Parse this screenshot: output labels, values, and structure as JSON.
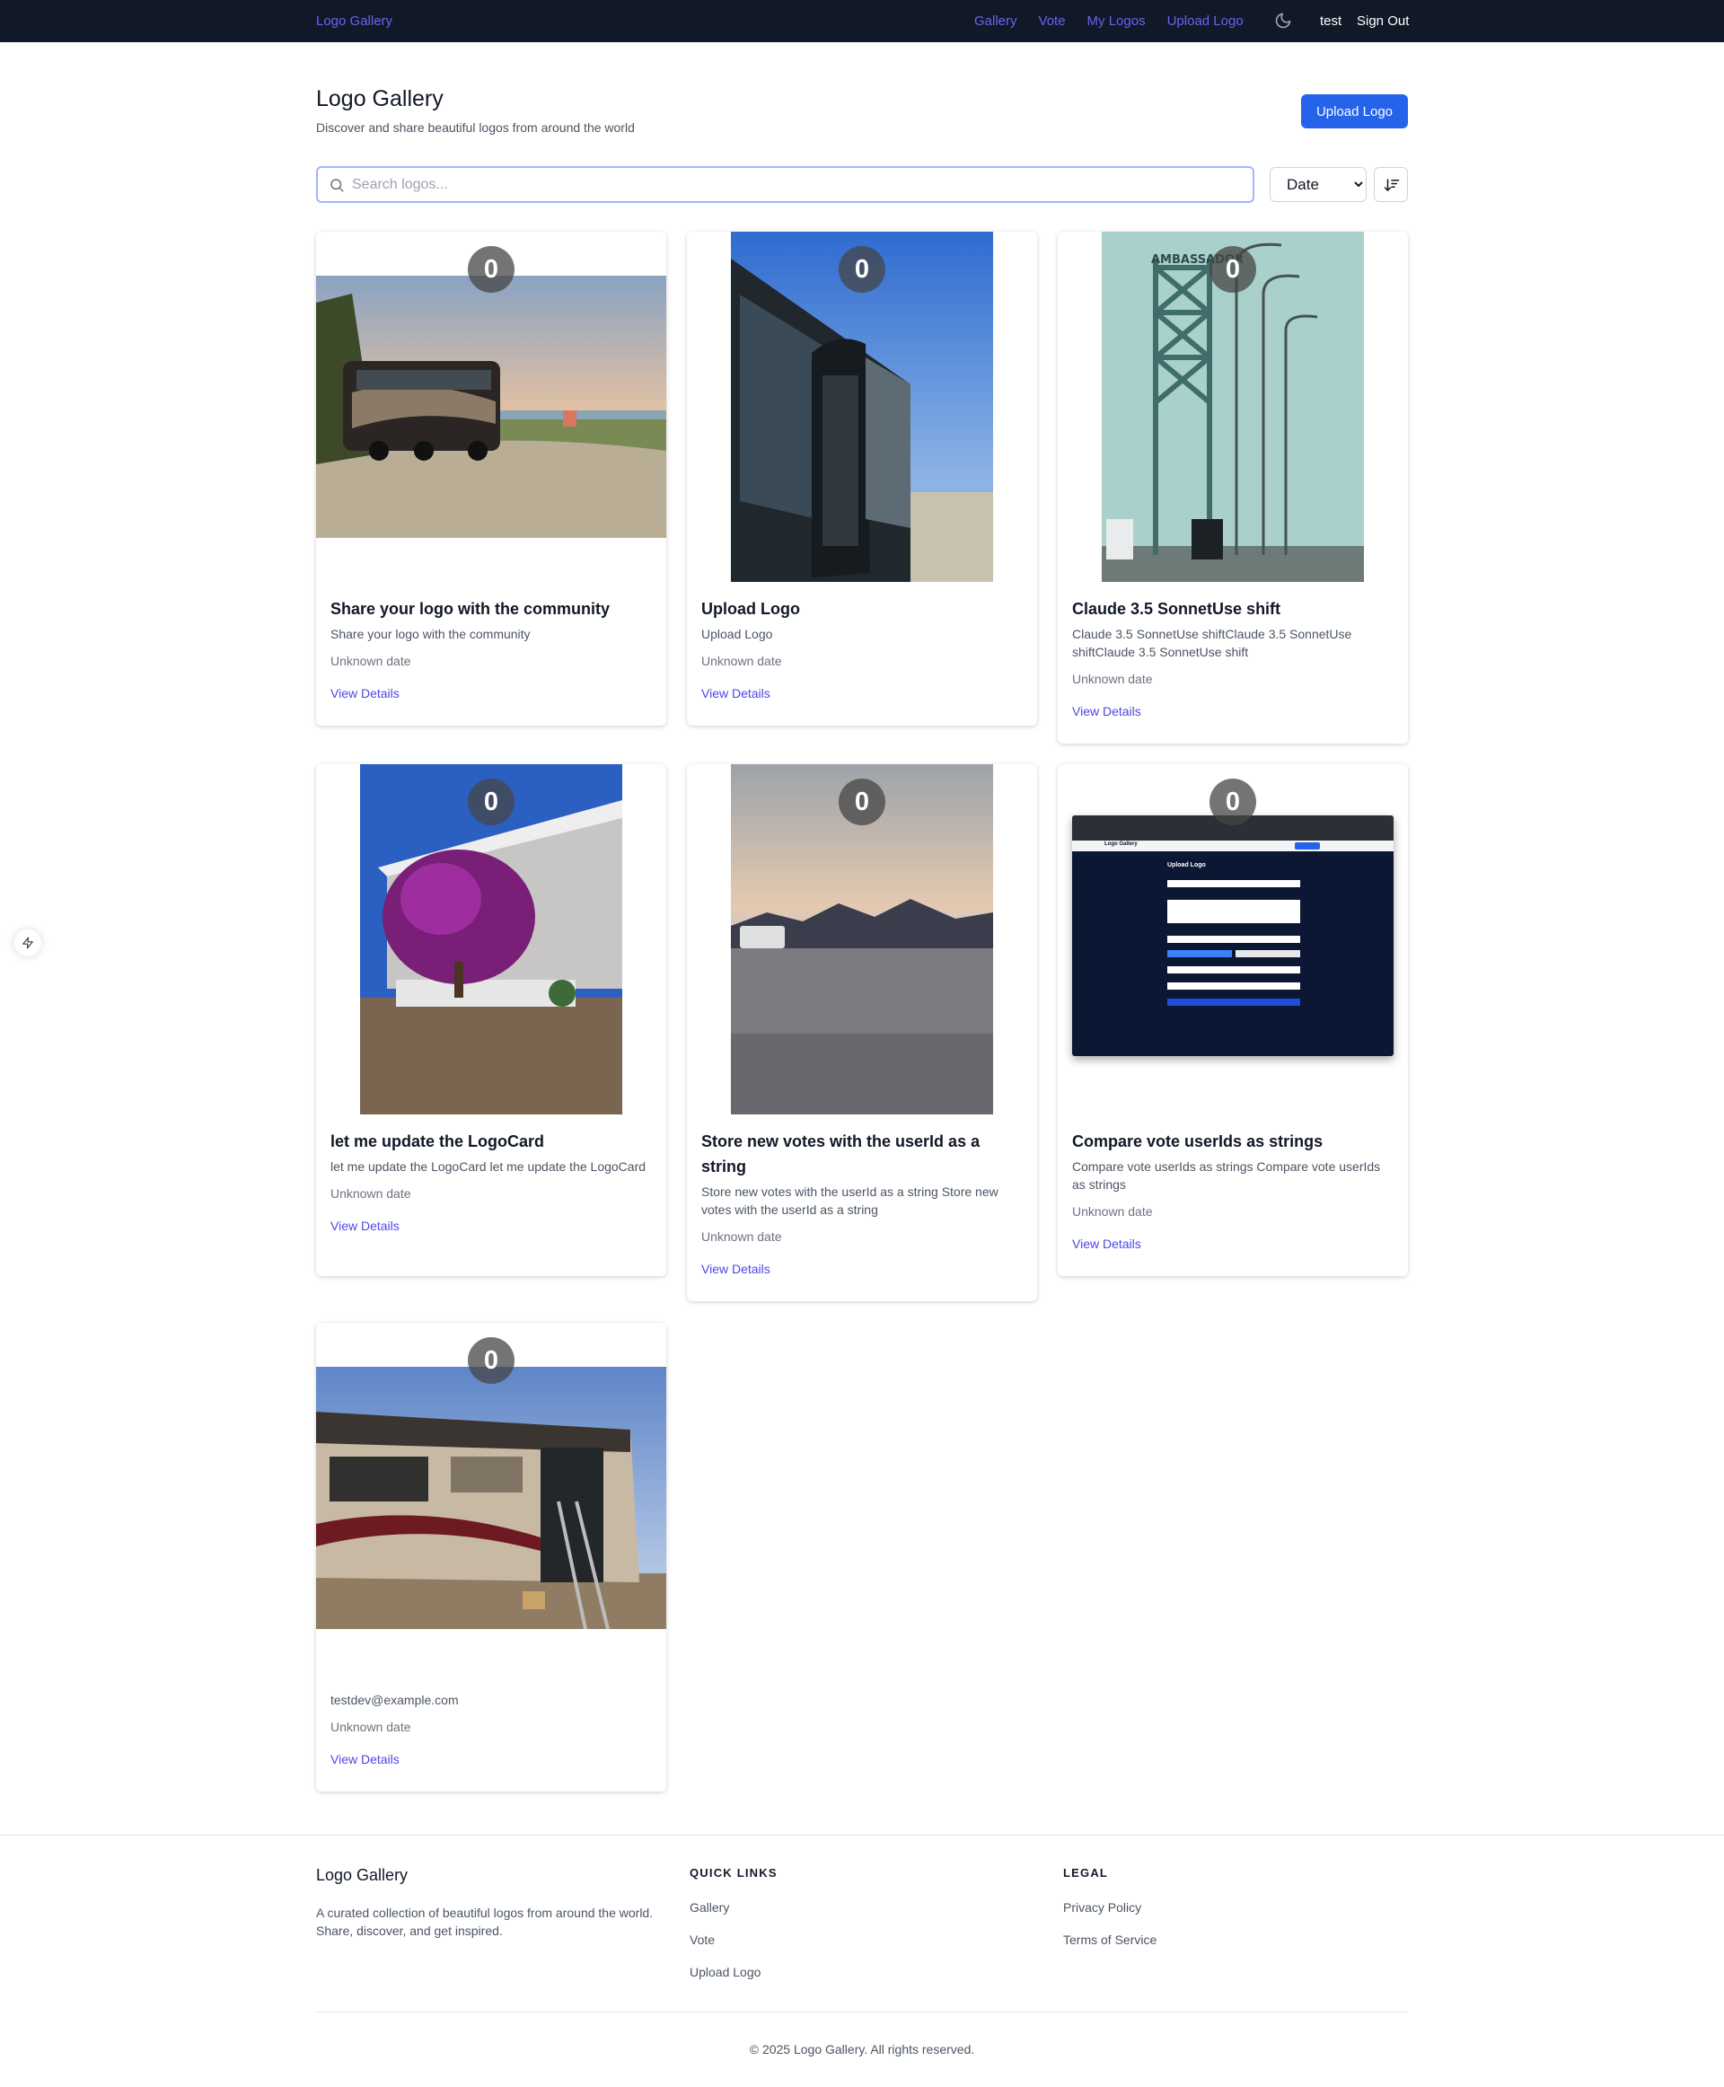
{
  "nav": {
    "brand": "Logo Gallery",
    "links": [
      "Gallery",
      "Vote",
      "My Logos",
      "Upload Logo"
    ],
    "theme_icon": "moon-icon",
    "user": "test",
    "signout": "Sign Out"
  },
  "header": {
    "title": "Logo Gallery",
    "subtitle": "Discover and share beautiful logos from around the world",
    "upload_label": "Upload Logo"
  },
  "search": {
    "placeholder": "Search logos...",
    "value": "",
    "sort_selected": "Date",
    "sort_icon": "sort-descending-icon"
  },
  "cards": [
    {
      "votes": "0",
      "title": "Share your logo with the community",
      "description": "Share your logo with the community",
      "date": "Unknown date",
      "link": "View Details",
      "image": "RV parked at sunset by a lake"
    },
    {
      "votes": "0",
      "title": "Upload Logo",
      "description": "Upload Logo",
      "date": "Unknown date",
      "link": "View Details",
      "image": "Side of RV against blue sky in desert"
    },
    {
      "votes": "0",
      "title": "Claude 3.5 SonnetUse shift",
      "description": "Claude 3.5 SonnetUse shiftClaude 3.5 SonnetUse shiftClaude 3.5 SonnetUse shift",
      "date": "Unknown date",
      "link": "View Details",
      "image": "Ambassador Bridge with trucks"
    },
    {
      "votes": "0",
      "title": "let me update the LogoCard",
      "description": "let me update the LogoCard let me update the LogoCard",
      "date": "Unknown date",
      "link": "View Details",
      "image": "Purple flowering tree in front of house"
    },
    {
      "votes": "0",
      "title": "Store new votes with the userId as a string",
      "description": "Store new votes with the userId as a string Store new votes with the userId as a string",
      "date": "Unknown date",
      "link": "View Details",
      "image": "Desert campsite at dusk with mountains"
    },
    {
      "votes": "0",
      "title": "Compare vote userIds as strings",
      "description": "Compare vote userIds as strings Compare vote userIds as strings",
      "date": "Unknown date",
      "link": "View Details",
      "image": "Screenshot of the Upload Logo form"
    },
    {
      "votes": "0",
      "title": "",
      "description": "testdev@example.com",
      "date": "Unknown date",
      "link": "View Details",
      "image": "RV with open door and ladder"
    }
  ],
  "screenshot_card": {
    "heading": "Upload Logo",
    "brand": "Logo Gallery"
  },
  "footer": {
    "title": "Logo Gallery",
    "description": "A curated collection of beautiful logos from around the world. Share, discover, and get inspired.",
    "quick_links_heading": "QUICK LINKS",
    "quick_links": [
      "Gallery",
      "Vote",
      "Upload Logo"
    ],
    "legal_heading": "LEGAL",
    "legal_links": [
      "Privacy Policy",
      "Terms of Service"
    ],
    "copyright": "© 2025 Logo Gallery. All rights reserved."
  },
  "colors": {
    "nav_bg": "#111827",
    "accent": "#6366f1",
    "primary": "#2563eb",
    "link": "#4f46e5"
  },
  "floating": {
    "icon": "lightning-icon"
  }
}
